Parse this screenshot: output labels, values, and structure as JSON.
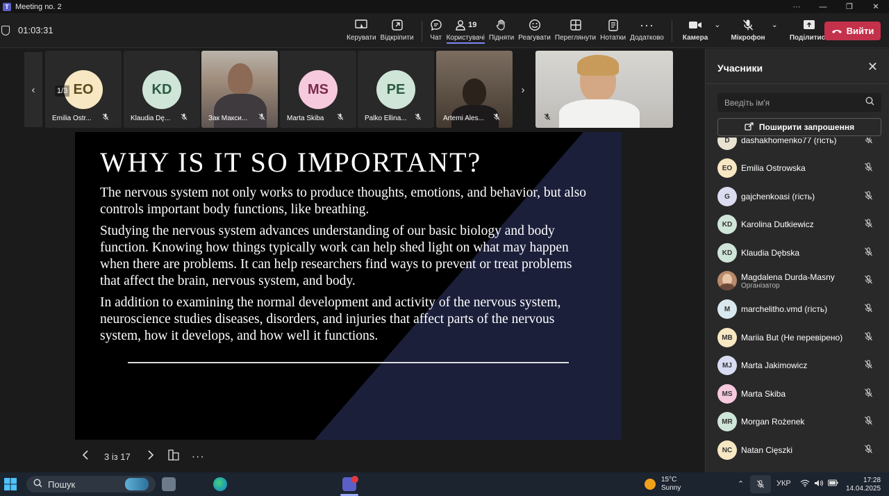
{
  "window": {
    "title": "Meeting no. 2",
    "controls": [
      "···",
      "—",
      "❐",
      "✕"
    ]
  },
  "toolbar": {
    "timer": "01:03:31",
    "tools": [
      {
        "name": "control",
        "label": "Керувати",
        "icon": "control-icon"
      },
      {
        "name": "popout",
        "label": "Відкріпити",
        "icon": "popout-icon"
      },
      {
        "name": "chat",
        "label": "Чат",
        "icon": "chat-icon"
      },
      {
        "name": "people",
        "label": "Користувачі",
        "icon": "people-icon",
        "count": "19"
      },
      {
        "name": "raise",
        "label": "Підняти",
        "icon": "hand-icon"
      },
      {
        "name": "react",
        "label": "Реагувати",
        "icon": "smile-icon"
      },
      {
        "name": "view",
        "label": "Переглянути",
        "icon": "grid-icon"
      },
      {
        "name": "notes",
        "label": "Нотатки",
        "icon": "notes-icon"
      },
      {
        "name": "more",
        "label": "Додатково",
        "icon": "more-icon"
      }
    ],
    "camera_label": "Камера",
    "mic_label": "Мікрофон",
    "share_label": "Поділитися",
    "leave_label": "Вийти"
  },
  "strip": {
    "page": "1/3",
    "tiles": [
      {
        "name": "Emilia Ostr...",
        "initials": "EO",
        "color": "#f7e7c2"
      },
      {
        "name": "Klaudia Dę...",
        "initials": "KD",
        "color": "#cfe5d8"
      },
      {
        "name": "Зак Макси...",
        "video": true
      },
      {
        "name": "Marta Skiba",
        "initials": "MS",
        "color": "#f6c9dc"
      },
      {
        "name": "Palko Ellina...",
        "initials": "PE",
        "color": "#cfe5d8"
      },
      {
        "name": "Artemi Ales...",
        "video": true
      }
    ]
  },
  "slide": {
    "title": "WHY IS IT SO IMPORTANT?",
    "paragraphs": [
      "The nervous system not only works to produce thoughts, emotions, and behavior, but also controls important body functions, like breathing.",
      "Studying the nervous system advances understanding of our basic biology and body function. Knowing how things typically work can help shed light on what may happen when there are problems. It can help researchers find ways to prevent or treat problems that affect the brain, nervous system, and body.",
      "In addition to examining the normal development and activity of the nervous system, neuroscience studies diseases, disorders, and injuries that affect parts of the nervous system, how it develops, and how well it functions."
    ],
    "accent_color": "#1b1f3a"
  },
  "slidenav": {
    "page": "3 із 17"
  },
  "participants": {
    "header": "Учасники",
    "search_placeholder": "Введіть ім'я",
    "share_invite": "Поширити запрошення",
    "list": [
      {
        "name": "dashakhomenko77 (гість)",
        "initials": "D",
        "color": "#e8e2d0"
      },
      {
        "name": "Emilia Ostrowska",
        "initials": "EO",
        "color": "#f7e7c2"
      },
      {
        "name": "gajchenkoasi (гість)",
        "initials": "G",
        "color": "#dcdcf0"
      },
      {
        "name": "Karolina Dutkiewicz",
        "initials": "KD",
        "color": "#cfe5d8"
      },
      {
        "name": "Klaudia Dębska",
        "initials": "KD",
        "color": "#cfe5d8"
      },
      {
        "name": "Magdalena Durda-Masny",
        "initials": "",
        "color": "#b88a6a",
        "role": "Організатор"
      },
      {
        "name": "marchelitho.vmd (гість)",
        "initials": "M",
        "color": "#d8e8ee"
      },
      {
        "name": "Mariia But (Не перевірено)",
        "initials": "MB",
        "color": "#f7e7c2"
      },
      {
        "name": "Marta Jakimowicz",
        "initials": "MJ",
        "color": "#d8dcf2"
      },
      {
        "name": "Marta Skiba",
        "initials": "MS",
        "color": "#f6c9dc"
      },
      {
        "name": "Morgan Rożenek",
        "initials": "MR",
        "color": "#cfe5d8"
      },
      {
        "name": "Natan Cięszki",
        "initials": "NC",
        "color": "#f7e7c2"
      }
    ]
  },
  "taskbar": {
    "search_label": "Пошук",
    "weather_temp": "15°C",
    "weather_desc": "Sunny",
    "lang": "УКР",
    "time": "17:28",
    "date": "14.04.2025"
  }
}
